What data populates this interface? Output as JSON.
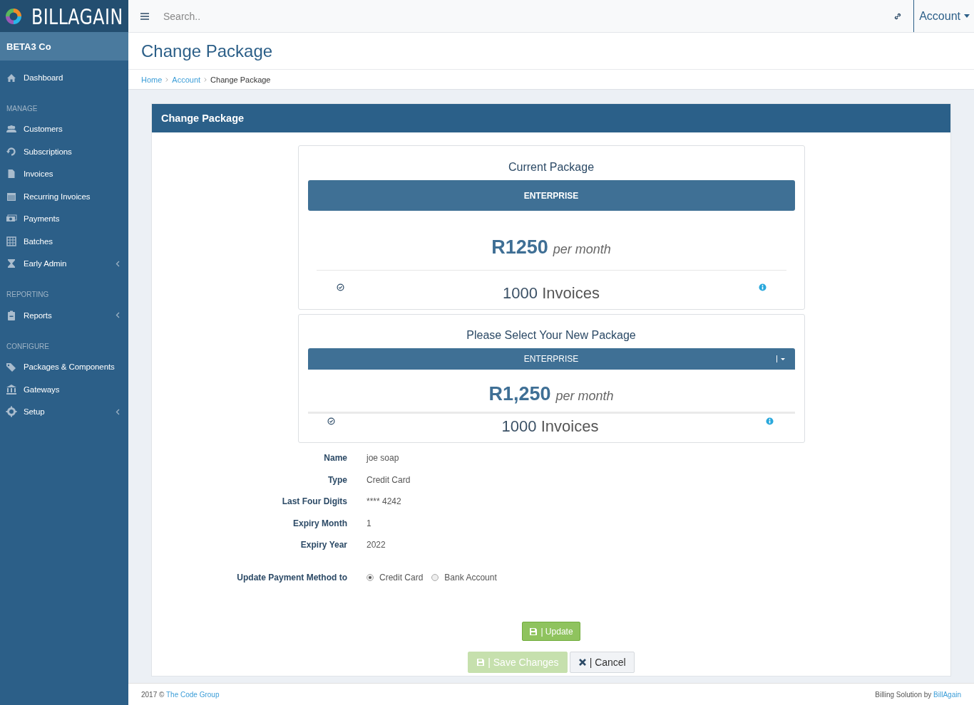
{
  "brand": {
    "logo_text": "**BILL**AGAIN"
  },
  "topbar": {
    "search": {
      "placeholder": "Search.."
    },
    "account_menu": "Account"
  },
  "sidebar": {
    "company": "BETA3 Co",
    "items": [
      {
        "label": "Dashboard",
        "submenu": false
      }
    ],
    "sections": [
      {
        "title": "MANAGE",
        "items": [
          {
            "label": "Customers",
            "submenu": false
          },
          {
            "label": "Subscriptions",
            "submenu": false
          },
          {
            "label": "Invoices",
            "submenu": false
          },
          {
            "label": "Recurring Invoices",
            "submenu": false
          },
          {
            "label": "Payments",
            "submenu": false
          },
          {
            "label": "Batches",
            "submenu": false
          },
          {
            "label": "Early Admin",
            "submenu": true
          }
        ]
      },
      {
        "title": "REPORTING",
        "items": [
          {
            "label": "Reports",
            "submenu": true
          }
        ]
      },
      {
        "title": "CONFIGURE",
        "items": [
          {
            "label": "Packages & Components",
            "submenu": false
          },
          {
            "label": "Gateways",
            "submenu": false
          },
          {
            "label": "Setup",
            "submenu": true
          }
        ]
      }
    ]
  },
  "page": {
    "title": "Change Package",
    "breadcrumb": [
      {
        "label": "Home",
        "link": true
      },
      {
        "label": "Account",
        "link": true
      },
      {
        "label": "Change Package",
        "link": false
      }
    ]
  },
  "panel": {
    "title": "Change Package",
    "current_package": {
      "title": "Current Package",
      "name": "ENTERPRISE",
      "price": "R1250",
      "period": "per month",
      "feature": "**1000** Invoices"
    },
    "new_package": {
      "title": "Please Select Your New Package",
      "selected": "ENTERPRISE",
      "price": "R1,250",
      "period": "per month",
      "feature": "**1000** Invoices"
    },
    "details": [
      {
        "label": "Name",
        "value": "joe soap"
      },
      {
        "label": "Type",
        "value": "Credit Card"
      },
      {
        "label": "Last Four Digits",
        "value": "**** 4242"
      },
      {
        "label": "Expiry Month",
        "value": "1"
      },
      {
        "label": "Expiry Year",
        "value": "2022"
      }
    ],
    "payment_method": {
      "label": "Update Payment Method to",
      "options": [
        {
          "label": "Credit Card",
          "selected": true
        },
        {
          "label": "Bank Account",
          "selected": false
        }
      ]
    },
    "update_button": "| Update",
    "save_button": {
      "label": "| Save Changes",
      "disabled": true
    },
    "cancel_button": "| Cancel"
  },
  "footer": {
    "left_text": "2017 © ",
    "left_link": "The Code Group",
    "right_text": "Billing Solution by ",
    "right_link": "BillAgain"
  }
}
